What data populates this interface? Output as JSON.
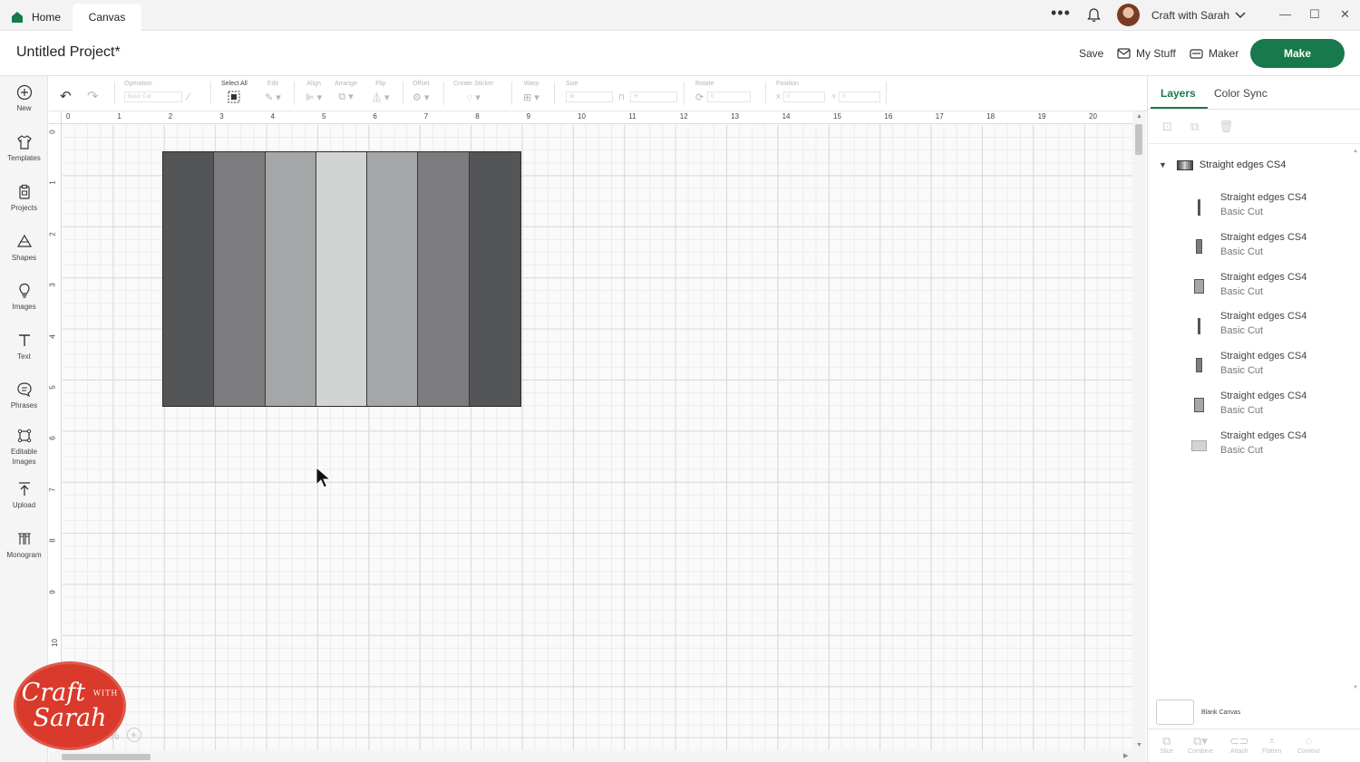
{
  "titlebar": {
    "tabs": [
      {
        "label": "Home"
      },
      {
        "label": "Canvas"
      }
    ],
    "more_icon": "ellipsis-icon",
    "bell_icon": "bell-icon",
    "account_name": "Craft with Sarah"
  },
  "header": {
    "project_title": "Untitled Project*",
    "save_label": "Save",
    "mystuff_label": "My Stuff",
    "maker_label": "Maker",
    "make_label": "Make",
    "accent_color": "#18794c"
  },
  "sidebar": {
    "items": [
      {
        "label": "New",
        "icon": "plus-circle-icon"
      },
      {
        "label": "Templates",
        "icon": "shirt-icon"
      },
      {
        "label": "Projects",
        "icon": "clipboard-icon"
      },
      {
        "label": "Shapes",
        "icon": "shapes-icon"
      },
      {
        "label": "Images",
        "icon": "lightbulb-icon"
      },
      {
        "label": "Text",
        "icon": "text-icon"
      },
      {
        "label": "Phrases",
        "icon": "speech-bubble-icon"
      },
      {
        "label": "Editable Images",
        "icon": "edit-image-icon"
      },
      {
        "label": "Upload",
        "icon": "upload-icon"
      },
      {
        "label": "Monogram",
        "icon": "monogram-icon"
      }
    ]
  },
  "toolbar": {
    "operation_label": "Operation",
    "operation_value": "Basic Cut",
    "select_all_label": "Select All",
    "edit_label": "Edit",
    "align_label": "Align",
    "arrange_label": "Arrange",
    "flip_label": "Flip",
    "offset_label": "Offset",
    "create_sticker_label": "Create Sticker",
    "warp_label": "Warp",
    "size_label": "Size",
    "size_w": "W",
    "size_h": "H",
    "rotate_label": "Rotate",
    "rotate_value": "0",
    "position_label": "Position",
    "pos_x": "X",
    "pos_x_value": "0",
    "pos_y": "Y",
    "pos_y_value": "0"
  },
  "canvas": {
    "ruler_top": [
      "0",
      "1",
      "2",
      "3",
      "4",
      "5",
      "6",
      "7",
      "8",
      "9",
      "10",
      "11",
      "12",
      "13",
      "14",
      "15",
      "16",
      "17",
      "18",
      "19",
      "20"
    ],
    "ruler_left": [
      "0",
      "1",
      "2",
      "3",
      "4",
      "5",
      "6",
      "7",
      "8",
      "9",
      "10"
    ],
    "zoom_text": "%",
    "stripe_colors": [
      "#545557",
      "#7c7c7e",
      "#a5a6a8",
      "#d2d4d4",
      "#a5a6a8",
      "#7c7c7e",
      "#545557"
    ]
  },
  "logo": {
    "line1": "Craft",
    "with": "WITH",
    "line2": "Sarah"
  },
  "panel": {
    "tabs": [
      {
        "label": "Layers"
      },
      {
        "label": "Color Sync"
      }
    ],
    "group_name": "Straight edges CS4",
    "layers": [
      {
        "name": "Straight edges CS4",
        "operation": "Basic Cut",
        "color": "#545557",
        "shape": "thin"
      },
      {
        "name": "Straight edges CS4",
        "operation": "Basic Cut",
        "color": "#7c7c7e",
        "shape": "medium"
      },
      {
        "name": "Straight edges CS4",
        "operation": "Basic Cut",
        "color": "#a5a6a8",
        "shape": "wide"
      },
      {
        "name": "Straight edges CS4",
        "operation": "Basic Cut",
        "color": "#545557",
        "shape": "thin"
      },
      {
        "name": "Straight edges CS4",
        "operation": "Basic Cut",
        "color": "#7c7c7e",
        "shape": "medium"
      },
      {
        "name": "Straight edges CS4",
        "operation": "Basic Cut",
        "color": "#a5a6a8",
        "shape": "wide"
      },
      {
        "name": "Straight edges CS4",
        "operation": "Basic Cut",
        "color": "#d2d4d4",
        "shape": "square"
      }
    ],
    "blank_canvas_label": "Blank Canvas",
    "bottom_tools": [
      {
        "label": "Slice",
        "icon": "slice-icon"
      },
      {
        "label": "Combine",
        "icon": "combine-icon"
      },
      {
        "label": "Attach",
        "icon": "attach-icon"
      },
      {
        "label": "Flatten",
        "icon": "flatten-icon"
      },
      {
        "label": "Contour",
        "icon": "contour-icon"
      }
    ]
  }
}
